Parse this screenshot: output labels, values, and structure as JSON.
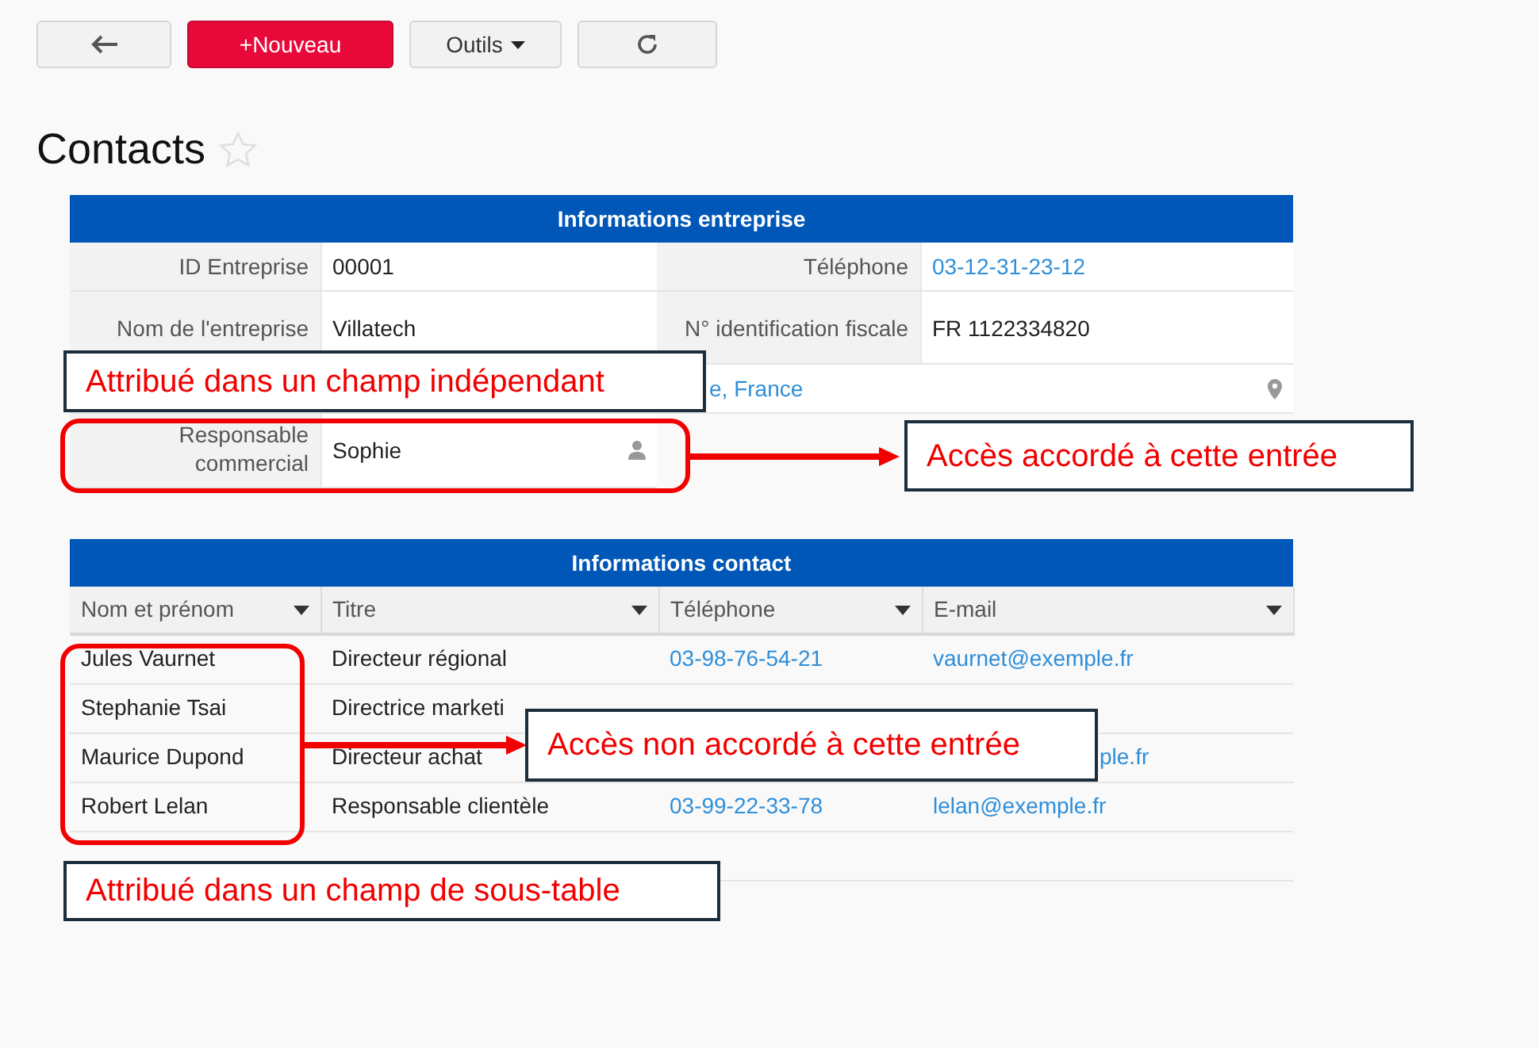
{
  "toolbar": [
    {
      "kind": "back"
    },
    {
      "kind": "new",
      "label": "+Nouveau"
    },
    {
      "kind": "menu",
      "label": "Outils"
    },
    {
      "kind": "refresh"
    }
  ],
  "page_title": "Contacts",
  "favorite": false,
  "company": {
    "title": "Informations entreprise",
    "rows": [
      [
        {
          "label": "ID Entreprise",
          "value": "00001"
        },
        {
          "label": "Téléphone",
          "value": "03-12-31-23-12",
          "kind": "phone"
        }
      ],
      [
        {
          "label": "Nom de l'entreprise",
          "value": "Villatech"
        },
        {
          "label": "N° identification fiscale",
          "value": "FR 1122334820"
        }
      ],
      [
        {
          "value": "e, France",
          "kind": "address",
          "covered": true,
          "colspan": 4
        }
      ],
      [
        {
          "label": "Responsable commercial",
          "value": "Sophie",
          "kind": "user"
        }
      ]
    ]
  },
  "contacts": {
    "title": "Informations contact",
    "columns": [
      {
        "label": "Nom et prénom",
        "kind": "text"
      },
      {
        "label": "Titre",
        "kind": "text"
      },
      {
        "label": "Téléphone",
        "kind": "link"
      },
      {
        "label": "E-mail",
        "kind": "link"
      }
    ],
    "rows": [
      {
        "cells": [
          "Jules Vaurnet",
          "Directeur régional",
          "03-98-76-54-21",
          "vaurnet@exemple.fr"
        ]
      },
      {
        "cells": [
          "Stephanie Tsai",
          "Directrice marketi",
          null,
          null
        ]
      },
      {
        "cells": [
          "Maurice Dupond",
          "Directeur achat",
          null,
          "ple.fr"
        ],
        "covered": true
      },
      {
        "cells": [
          "Robert Lelan",
          "Responsable clientèle",
          "03-99-22-33-78",
          "lelan@exemple.fr"
        ]
      }
    ]
  },
  "annotations": [
    {
      "kind": "callout",
      "text": "Attribué dans un champ indépendant"
    },
    {
      "kind": "highlight"
    },
    {
      "kind": "arrow"
    },
    {
      "kind": "callout",
      "text": "Accès accordé à cette entrée"
    },
    {
      "kind": "highlight"
    },
    {
      "kind": "arrow"
    },
    {
      "kind": "callout",
      "text": "Accès non accordé à cette entrée"
    },
    {
      "kind": "callout",
      "text": "Attribué dans un champ de sous-table"
    }
  ]
}
